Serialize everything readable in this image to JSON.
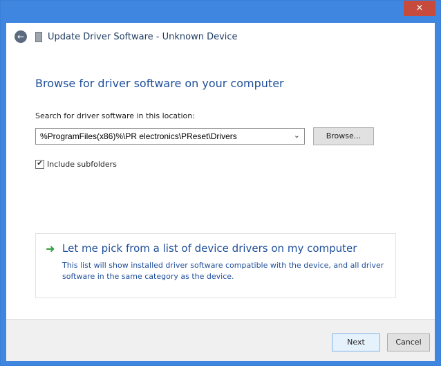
{
  "window": {
    "title": "Update Driver Software - Unknown Device",
    "close_glyph": "×",
    "back_glyph": "←",
    "device_icon": "device-icon"
  },
  "content": {
    "heading": "Browse for driver software on your computer",
    "search_label": "Search for driver software in this location:",
    "path_value": "%ProgramFiles(x86)%\\PR electronics\\PReset\\Drivers",
    "dropdown_glyph": "⌄",
    "browse_label": "Browse...",
    "include_subfolders_label": "Include subfolders",
    "include_subfolders_checked": true,
    "check_glyph": "✔"
  },
  "option": {
    "arrow_glyph": "➜",
    "title": "Let me pick from a list of device drivers on my computer",
    "description": "This list will show installed driver software compatible with the device, and all driver software in the same category as the device."
  },
  "footer": {
    "next_label": "Next",
    "cancel_label": "Cancel"
  },
  "colors": {
    "title_bar": "#3f86e0",
    "close_button": "#c74b3c",
    "link_blue": "#1e4e9a",
    "arrow_green": "#2f9e3f"
  }
}
